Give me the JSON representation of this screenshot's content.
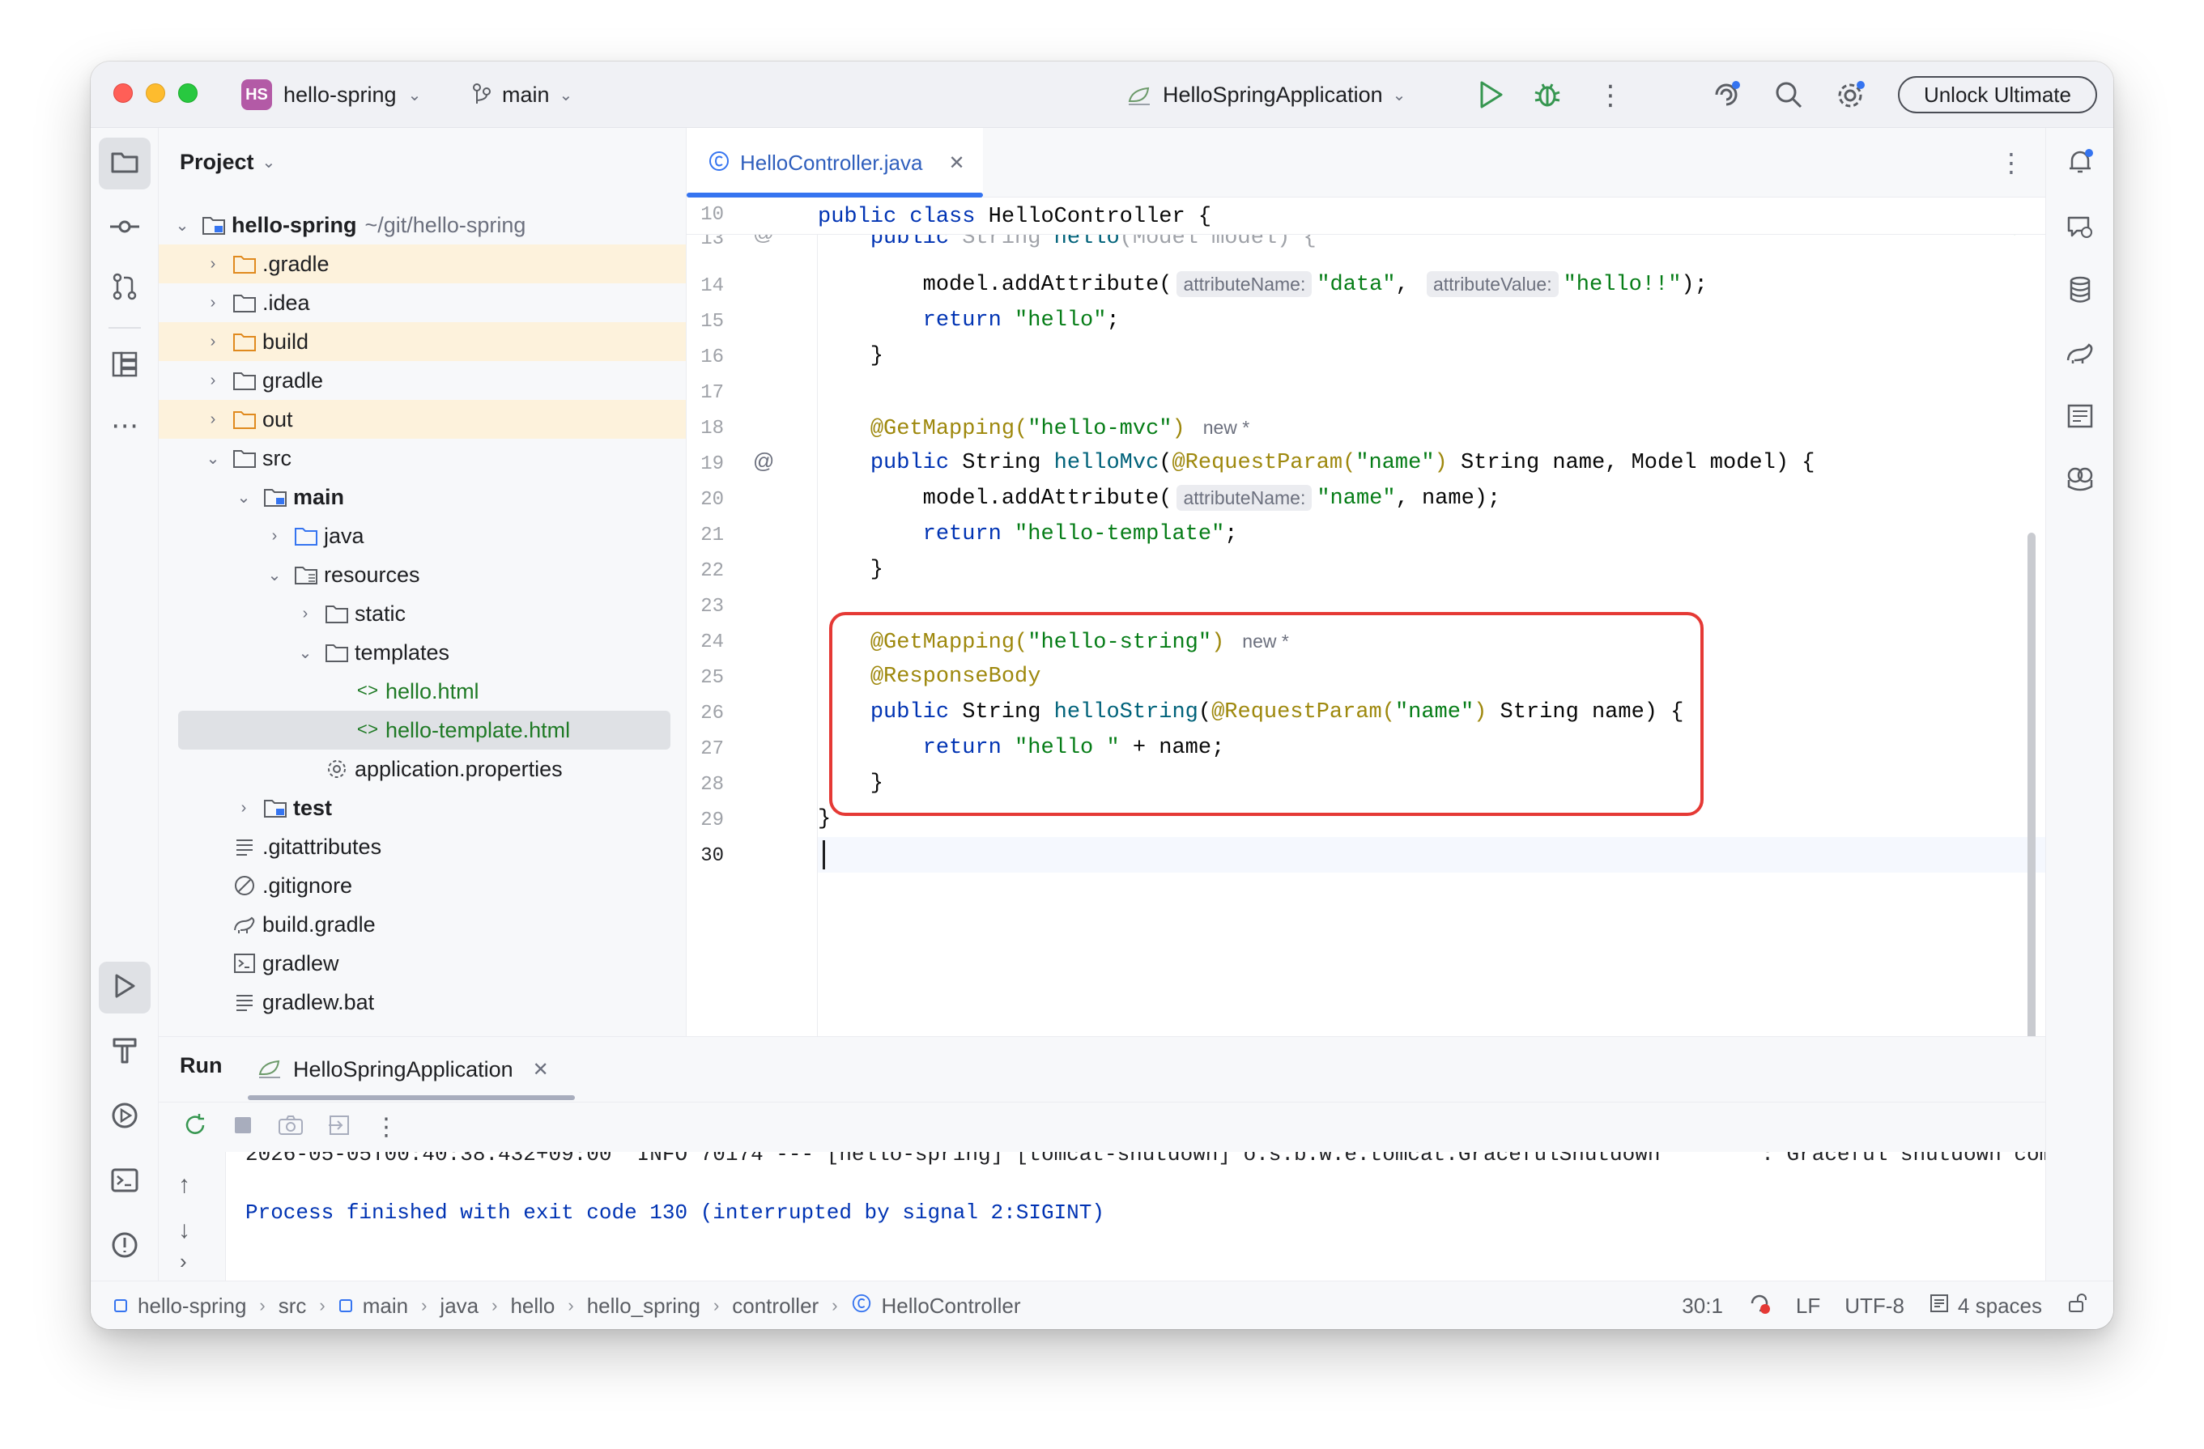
{
  "titlebar": {
    "project_badge": "HS",
    "project_name": "hello-spring",
    "branch": "main",
    "run_config": "HelloSpringApplication",
    "unlock_label": "Unlock Ultimate"
  },
  "project_panel": {
    "title": "Project",
    "root_name": "hello-spring",
    "root_path": "~/git/hello-spring",
    "items": [
      {
        "label": ".gradle"
      },
      {
        "label": ".idea"
      },
      {
        "label": "build"
      },
      {
        "label": "gradle"
      },
      {
        "label": "out"
      },
      {
        "label": "src"
      },
      {
        "label": "main"
      },
      {
        "label": "java"
      },
      {
        "label": "resources"
      },
      {
        "label": "static"
      },
      {
        "label": "templates"
      },
      {
        "label": "hello.html"
      },
      {
        "label": "hello-template.html"
      },
      {
        "label": "application.properties"
      },
      {
        "label": "test"
      },
      {
        "label": ".gitattributes"
      },
      {
        "label": ".gitignore"
      },
      {
        "label": "build.gradle"
      },
      {
        "label": "gradlew"
      },
      {
        "label": "gradlew.bat"
      }
    ]
  },
  "editor": {
    "tab_label": "HelloController.java",
    "sticky_line_number": "10",
    "sticky_text": "public class HelloController {",
    "line_numbers": [
      "14",
      "15",
      "16",
      "17",
      "18",
      "19",
      "20",
      "21",
      "22",
      "23",
      "24",
      "25",
      "26",
      "27",
      "28",
      "29",
      "30"
    ],
    "partial_line_number": "13",
    "inlay": {
      "attributeName": "attributeName:",
      "attributeValue": "attributeValue:",
      "new_marker": "new *"
    },
    "strings": {
      "data": "\"data\"",
      "hello_bang": "\"hello!!\"",
      "hello": "\"hello\"",
      "hello_mvc": "\"hello-mvc\"",
      "name": "\"name\"",
      "hello_template": "\"hello-template\"",
      "hello_string": "\"hello-string\"",
      "hello_space": "\"hello \""
    }
  },
  "run_panel": {
    "title": "Run",
    "tab_label": "HelloSpringApplication",
    "previous_log": "2026-05-05T00:40:38.432+09:00  INFO 70174 --- [hello-spring] [tomcat-shutdown] o.s.b.w.e.tomcat.GracefulShutdown        : Graceful shutdown com",
    "exit_message": "Process finished with exit code 130 (interrupted by signal 2:SIGINT)"
  },
  "statusbar": {
    "breadcrumbs": [
      "hello-spring",
      "src",
      "main",
      "java",
      "hello",
      "hello_spring",
      "controller",
      "HelloController"
    ],
    "position": "30:1",
    "line_ending": "LF",
    "encoding": "UTF-8",
    "indent": "4 spaces"
  },
  "colors": {
    "accent": "#3574f0",
    "highlight_box": "#e53935",
    "keyword": "#0033b3",
    "string": "#067d17",
    "annotation": "#9e880d"
  }
}
